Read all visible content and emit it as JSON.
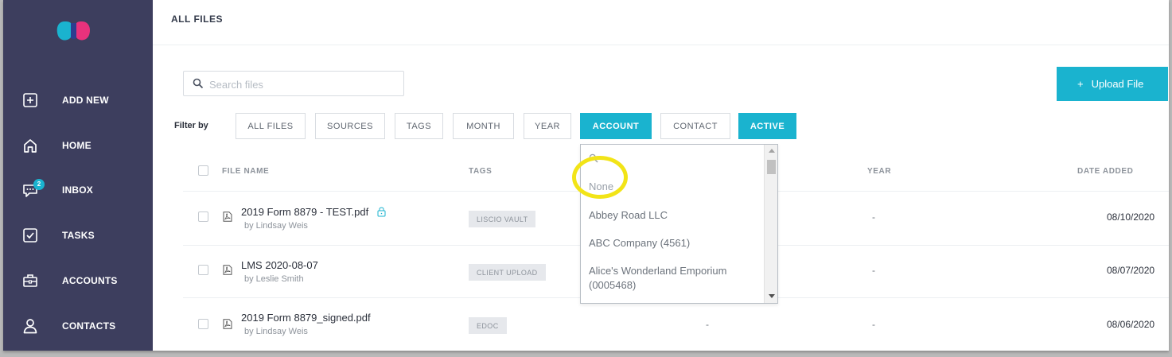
{
  "sidebar": {
    "logo": "app-logo",
    "items": [
      {
        "label": "ADD NEW",
        "icon": "plus-square-icon"
      },
      {
        "label": "HOME",
        "icon": "home-icon"
      },
      {
        "label": "INBOX",
        "icon": "chat-icon",
        "badge": "2"
      },
      {
        "label": "TASKS",
        "icon": "check-square-icon"
      },
      {
        "label": "ACCOUNTS",
        "icon": "briefcase-icon"
      },
      {
        "label": "CONTACTS",
        "icon": "user-icon"
      }
    ]
  },
  "header": {
    "title": "ALL FILES"
  },
  "search": {
    "placeholder": "Search files",
    "value": ""
  },
  "upload": {
    "label": "Upload File",
    "plus": "+"
  },
  "filters": {
    "label": "Filter by",
    "buttons": [
      {
        "label": "ALL FILES",
        "active": false
      },
      {
        "label": "SOURCES",
        "active": false
      },
      {
        "label": "TAGS",
        "active": false
      },
      {
        "label": "MONTH",
        "active": false
      },
      {
        "label": "YEAR",
        "active": false
      },
      {
        "label": "ACCOUNT",
        "active": true
      },
      {
        "label": "CONTACT",
        "active": false
      },
      {
        "label": "ACTIVE",
        "active": true
      }
    ]
  },
  "table": {
    "headers": {
      "file_name": "FILE NAME",
      "tags": "TAGS",
      "year": "YEAR",
      "date_added": "DATE ADDED"
    },
    "rows": [
      {
        "name": "2019 Form 8879 - TEST.pdf",
        "by": "by Lindsay Weis",
        "tag": "LISCIO VAULT",
        "locked": true,
        "account": "",
        "year": "-",
        "date": "08/10/2020"
      },
      {
        "name": "LMS 2020-08-07",
        "by": "by Leslie Smith",
        "tag": "CLIENT UPLOAD",
        "locked": false,
        "account": "",
        "year": "-",
        "date": "08/07/2020"
      },
      {
        "name": "2019 Form 8879_signed.pdf",
        "by": "by Lindsay Weis",
        "tag": "EDOC",
        "locked": false,
        "account": "-",
        "year": "-",
        "date": "08/06/2020"
      }
    ]
  },
  "dropdown": {
    "options": [
      "None",
      "Abbey Road LLC",
      "ABC Company (4561)",
      "Alice's Wonderland Emporium",
      "(0005468)"
    ]
  },
  "colors": {
    "sidebar": "#3d3e5e",
    "accent": "#1ab3cf",
    "highlight": "#f2e417"
  }
}
